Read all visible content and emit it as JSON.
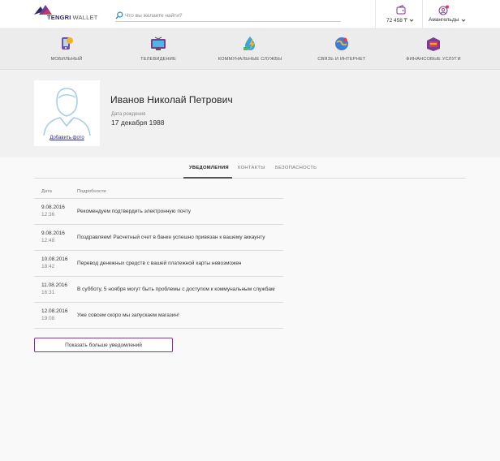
{
  "header": {
    "logo_brand": "TENGRI",
    "logo_suffix": "WALLET",
    "search_placeholder": "Что вы желаете найти?",
    "balance": "72 458 ₸",
    "username": "Амангельды",
    "accent_color": "#7b3b8f",
    "notification_dot_color": "#e63950"
  },
  "categories": [
    {
      "label": "МОБИЛЬНЫЙ",
      "icon": "mobile-icon"
    },
    {
      "label": "ТЕЛЕВИДЕНИЕ",
      "icon": "tv-icon"
    },
    {
      "label": "КОММУНАЛЬНЫЕ СЛУЖБЫ",
      "icon": "utilities-icon"
    },
    {
      "label": "СВЯЗЬ И ИНТЕРНЕТ",
      "icon": "internet-icon"
    },
    {
      "label": "ФИНАНСОВЫЕ УСЛУГИ",
      "icon": "finance-icon"
    }
  ],
  "profile": {
    "name": "Иванов Николай Петрович",
    "dob_label": "Дата рождения",
    "dob_value": "17 декабря 1988",
    "add_photo": "Добавить фото"
  },
  "tabs": [
    {
      "label": "УВЕДОМЛЕНИЯ",
      "active": true
    },
    {
      "label": "КОНТАКТЫ",
      "active": false
    },
    {
      "label": "БЕЗОПАСНОСТЬ",
      "active": false
    }
  ],
  "notifications": {
    "col_date": "Дата",
    "col_details": "Подробности",
    "rows": [
      {
        "date": "9.08.2016",
        "time": "12:36",
        "text": "Рекомендуем подтвердить электронную почту"
      },
      {
        "date": "9.08.2016",
        "time": "12:48",
        "text": "Поздравляем! Расчетный счет в банке успешно привязан к вашему аккаунту"
      },
      {
        "date": "10.08.2016",
        "time": "18:42",
        "text": "Перевод денежных средств с вашей платежной карты невозможен"
      },
      {
        "date": "11.08.2016",
        "time": "16:31",
        "text": "В субботу, 5 ноября могут быть проблемы с доступом к коммунальным службам"
      },
      {
        "date": "12.08.2016",
        "time": "19:08",
        "text": "Уже совсем скоро мы запускаем магазин!"
      }
    ],
    "more_button": "Показать больше уведомлений"
  }
}
